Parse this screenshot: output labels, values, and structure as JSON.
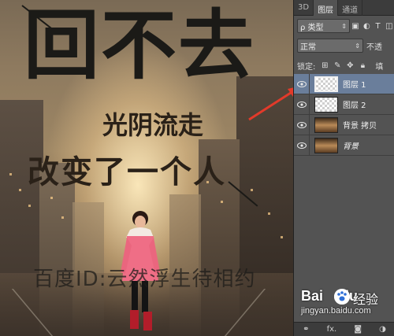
{
  "canvas": {
    "title_big": "回不去",
    "title_mid": "光阴流走",
    "title_low": "改变了一个人",
    "watermark": "百度ID:云然浮生待相约",
    "baidu_logo": "Bai",
    "baidu_logo_du": "du",
    "baidu_jingyan": "经验",
    "baidu_url": "jingyan.baidu.com"
  },
  "panel": {
    "tabs": [
      {
        "label": "3D",
        "active": false
      },
      {
        "label": "图层",
        "active": true
      },
      {
        "label": "通道",
        "active": false
      }
    ],
    "filter_kind": "ρ 类型",
    "blend_mode": "正常",
    "opacity_label": "不透",
    "lock_label": "锁定:",
    "fill_label": "填",
    "layers": [
      {
        "name": "图层 1",
        "thumb": "checker",
        "selected": true,
        "italic": false
      },
      {
        "name": "图层 2",
        "thumb": "checker",
        "selected": false,
        "italic": false
      },
      {
        "name": "背景 拷贝",
        "thumb": "photo",
        "selected": false,
        "italic": false
      },
      {
        "name": "背景",
        "thumb": "photo",
        "selected": false,
        "italic": true
      }
    ],
    "footer_icons": [
      "link-icon",
      "fx-icon",
      "mask-icon",
      "adjustment-icon"
    ],
    "footer_fx": "fx."
  },
  "colors": {
    "panel_bg": "#535353",
    "selected_layer": "#6a7e9b",
    "arrow": "#e23a2a"
  }
}
